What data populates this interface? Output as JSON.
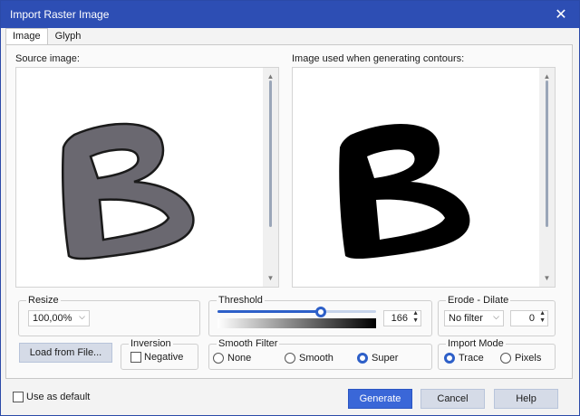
{
  "window": {
    "title": "Import Raster Image",
    "close_glyph": "✕"
  },
  "tabs": [
    {
      "label": "Image"
    },
    {
      "label": "Glyph"
    }
  ],
  "source_image": {
    "label": "Source image:"
  },
  "contour_image": {
    "label": "Image used when generating contours:"
  },
  "scroll": {
    "up": "▲",
    "down": "▼"
  },
  "resize": {
    "title": "Resize",
    "value": "100,00%"
  },
  "threshold": {
    "title": "Threshold",
    "value": "166",
    "level_fraction": 0.65
  },
  "erode_dilate": {
    "title": "Erode - Dilate",
    "filter": "No filter",
    "value": "0"
  },
  "load_button": {
    "label": "Load from File..."
  },
  "inversion": {
    "title": "Inversion",
    "negative_label": "Negative",
    "negative_checked": false
  },
  "smooth_filter": {
    "title": "Smooth Filter",
    "options": [
      "None",
      "Smooth",
      "Super"
    ],
    "selected": "Super"
  },
  "import_mode": {
    "title": "Import Mode",
    "options": [
      "Trace",
      "Pixels"
    ],
    "selected": "Trace"
  },
  "footer": {
    "use_default_label": "Use as default",
    "generate": "Generate",
    "cancel": "Cancel",
    "help": "Help"
  },
  "glyphs": {
    "chevron": "⌵",
    "spin_up": "▲",
    "spin_down": "▼"
  },
  "colors": {
    "titlebar": "#2d4eb4",
    "accent": "#2d5fc8",
    "source_letter": "#6a6870",
    "contour_letter": "#000000"
  }
}
